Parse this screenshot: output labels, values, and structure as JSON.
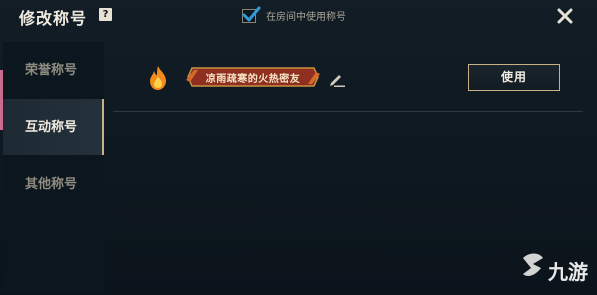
{
  "dialog": {
    "title": "修改称号",
    "help_icon": "question-icon",
    "help_text": "?",
    "checkbox": {
      "label": "在房间中使用称号",
      "checked": true
    },
    "close_icon": "close-icon"
  },
  "sidebar": {
    "items": [
      {
        "label": "荣誉称号",
        "active": false
      },
      {
        "label": "互动称号",
        "active": true
      },
      {
        "label": "其他称号",
        "active": false
      }
    ]
  },
  "title_row": {
    "icon": "fire-icon",
    "badge_text": "凉雨疏寒的火热密友",
    "edit_icon": "pencil-icon",
    "use_button": "使用"
  },
  "watermark": {
    "logo_icon": "watermark-logo-icon",
    "text": "九游"
  },
  "colors": {
    "background": "#0e1820",
    "accent_gold": "#c7b286",
    "badge_red": "#8e2f20",
    "check_blue": "#2f9ad6"
  }
}
